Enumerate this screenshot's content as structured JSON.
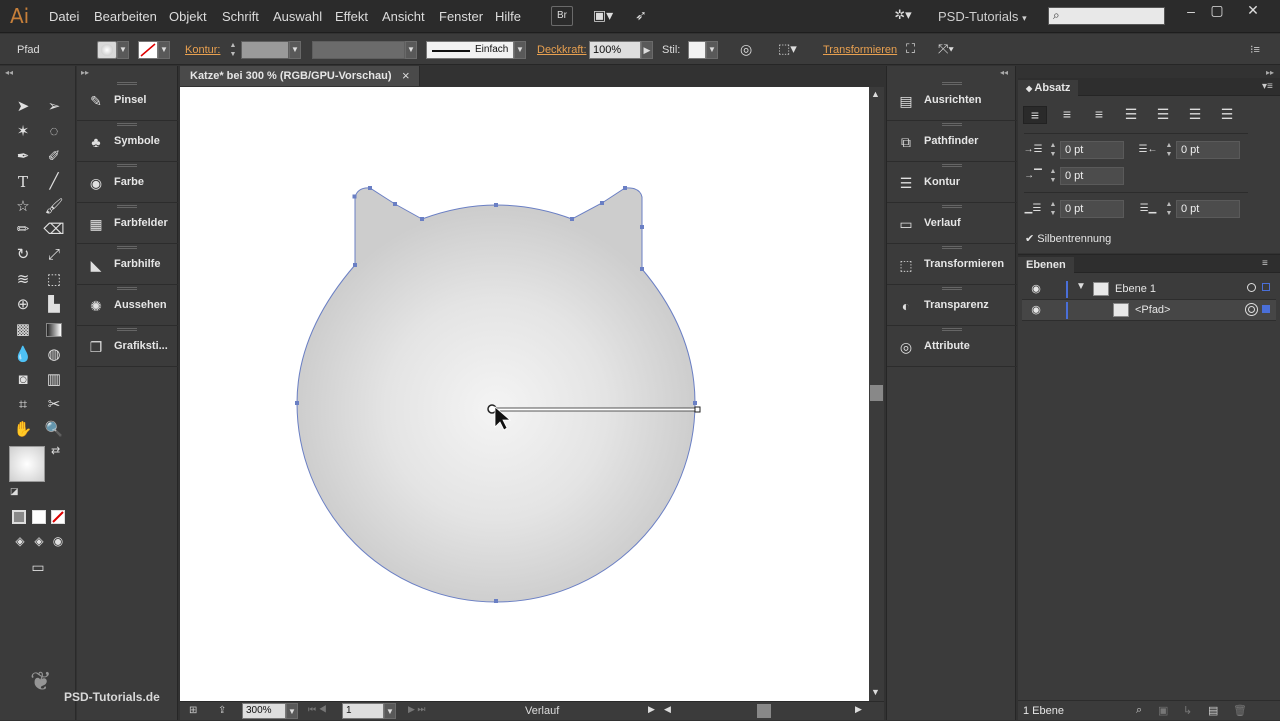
{
  "app": {
    "logo": "Ai",
    "workspace": "PSD-Tutorials"
  },
  "menu": [
    "Datei",
    "Bearbeiten",
    "Objekt",
    "Schrift",
    "Auswahl",
    "Effekt",
    "Ansicht",
    "Fenster",
    "Hilfe"
  ],
  "toolbar_buttons": {
    "bridge": "Br"
  },
  "control": {
    "object_type": "Pfad",
    "kontur_label": "Kontur:",
    "stroke_style": "Einfach",
    "opacity_label": "Deckkraft:",
    "opacity_value": "100%",
    "style_label": "Stil:",
    "transform_link": "Transformieren"
  },
  "document": {
    "tab_title": "Katze* bei 300 % (RGB/GPU-Vorschau)",
    "close": "×"
  },
  "left_panels": [
    {
      "name": "pinsel",
      "label": "Pinsel",
      "icon": "brush-icon",
      "glyph": "✎"
    },
    {
      "name": "symbole",
      "label": "Symbole",
      "icon": "club-icon",
      "glyph": "♣"
    },
    {
      "name": "farbe",
      "label": "Farbe",
      "icon": "palette-icon",
      "glyph": "◉"
    },
    {
      "name": "farbfelder",
      "label": "Farbfelder",
      "icon": "swatches-icon",
      "glyph": "▦"
    },
    {
      "name": "farbhilfe",
      "label": "Farbhilfe",
      "icon": "color-guide-icon",
      "glyph": "◣"
    },
    {
      "name": "aussehen",
      "label": "Aussehen",
      "icon": "appearance-icon",
      "glyph": "✺"
    },
    {
      "name": "grafikstile",
      "label": "Grafiksti...",
      "icon": "graphic-styles-icon",
      "glyph": "❐"
    }
  ],
  "right_panels": [
    {
      "name": "ausrichten",
      "label": "Ausrichten",
      "icon": "align-icon",
      "glyph": "▤"
    },
    {
      "name": "pathfinder",
      "label": "Pathfinder",
      "icon": "pathfinder-icon",
      "glyph": "⧉"
    },
    {
      "name": "kontur",
      "label": "Kontur",
      "icon": "stroke-icon",
      "glyph": "☰"
    },
    {
      "name": "verlauf",
      "label": "Verlauf",
      "icon": "gradient-icon",
      "glyph": "▭"
    },
    {
      "name": "transformieren",
      "label": "Transformieren",
      "icon": "transform-icon",
      "glyph": "⬚"
    },
    {
      "name": "transparenz",
      "label": "Transparenz",
      "icon": "transparency-icon",
      "glyph": "◐"
    },
    {
      "name": "attribute",
      "label": "Attribute",
      "icon": "attributes-icon",
      "glyph": "◎"
    }
  ],
  "absatz": {
    "title": "Absatz",
    "left_indent": "0 pt",
    "right_indent": "0 pt",
    "first_line_indent": "0 pt",
    "space_before": "0 pt",
    "space_after": "0 pt",
    "hyphenation_label": "Silbentrennung",
    "hyphenation_checked": true
  },
  "layers": {
    "title": "Ebenen",
    "rows": [
      {
        "name": "Ebene 1",
        "expanded": true
      },
      {
        "name": "<Pfad>"
      }
    ],
    "count_label": "1 Ebene"
  },
  "status": {
    "zoom": "300%",
    "artboard": "1",
    "current_tool": "Verlauf"
  },
  "watermark": "PSD-Tutorials.de",
  "colors": {
    "accent": "#e8a050",
    "path_stroke": "#6a7fc4",
    "layer_color": "#4a6fd8"
  }
}
